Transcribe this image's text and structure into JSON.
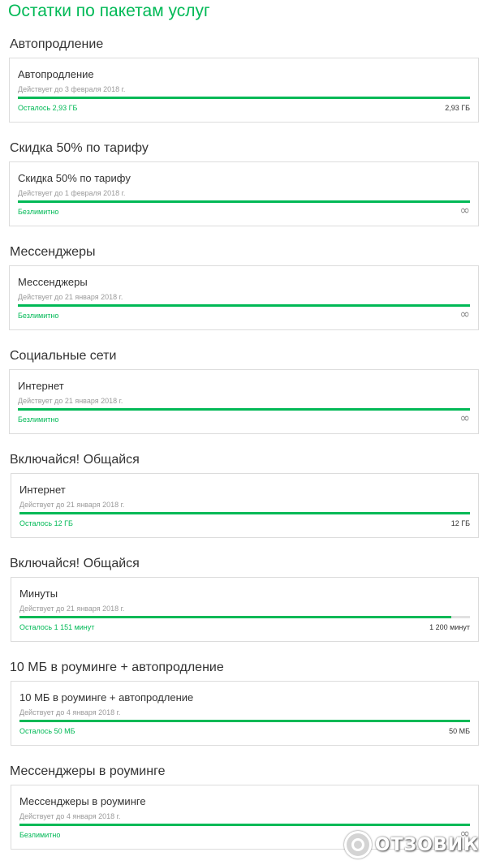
{
  "page_title": "Остатки по пакетам услуг",
  "colors": {
    "accent": "#00b956",
    "track": "#e1e1e1",
    "border": "#dcdcdc"
  },
  "sections": [
    {
      "title": "Автопродление",
      "card": {
        "name": "Автопродление",
        "valid": "Действует до 3 февраля 2018 г.",
        "remaining": "Осталось 2,93 ГБ",
        "total": "2,93 ГБ",
        "unlimited": false,
        "fill_percent": 100
      }
    },
    {
      "title": "Скидка 50% по тарифу",
      "card": {
        "name": "Скидка 50% по тарифу",
        "valid": "Действует до 1 февраля 2018 г.",
        "remaining": "Безлимитно",
        "total": "",
        "unlimited": true,
        "fill_percent": 100
      }
    },
    {
      "title": "Мессенджеры",
      "card": {
        "name": "Мессенджеры",
        "valid": "Действует до 21 января 2018 г.",
        "remaining": "Безлимитно",
        "total": "",
        "unlimited": true,
        "fill_percent": 100
      }
    },
    {
      "title": "Социальные сети",
      "card": {
        "name": "Интернет",
        "valid": "Действует до 21 января 2018 г.",
        "remaining": "Безлимитно",
        "total": "",
        "unlimited": true,
        "fill_percent": 100
      }
    },
    {
      "title": "Включайся! Общайся",
      "card": {
        "name": "Интернет",
        "valid": "Действует до 21 января 2018 г.",
        "remaining": "Осталось 12 ГБ",
        "total": "12 ГБ",
        "unlimited": false,
        "fill_percent": 100
      }
    },
    {
      "title": "Включайся! Общайся",
      "card": {
        "name": "Минуты",
        "valid": "Действует до 21 января 2018 г.",
        "remaining": "Осталось 1 151 минут",
        "total": "1 200 минут",
        "unlimited": false,
        "fill_percent": 95.9
      }
    },
    {
      "title": "10 МБ в роуминге + автопродление",
      "card": {
        "name": "10 МБ в роуминге + автопродление",
        "valid": "Действует до 4 января 2018 г.",
        "remaining": "Осталось 50 МБ",
        "total": "50 МБ",
        "unlimited": false,
        "fill_percent": 100
      }
    },
    {
      "title": "Мессенджеры в роуминге",
      "card": {
        "name": "Мессенджеры в роуминге",
        "valid": "Действует до 4 января 2018 г.",
        "remaining": "Безлимитно",
        "total": "",
        "unlimited": true,
        "fill_percent": 100
      }
    }
  ],
  "infinity_glyph": "∞",
  "watermark": {
    "text": "ОТЗОВИК",
    "icon": "otzovik-logo-icon"
  }
}
